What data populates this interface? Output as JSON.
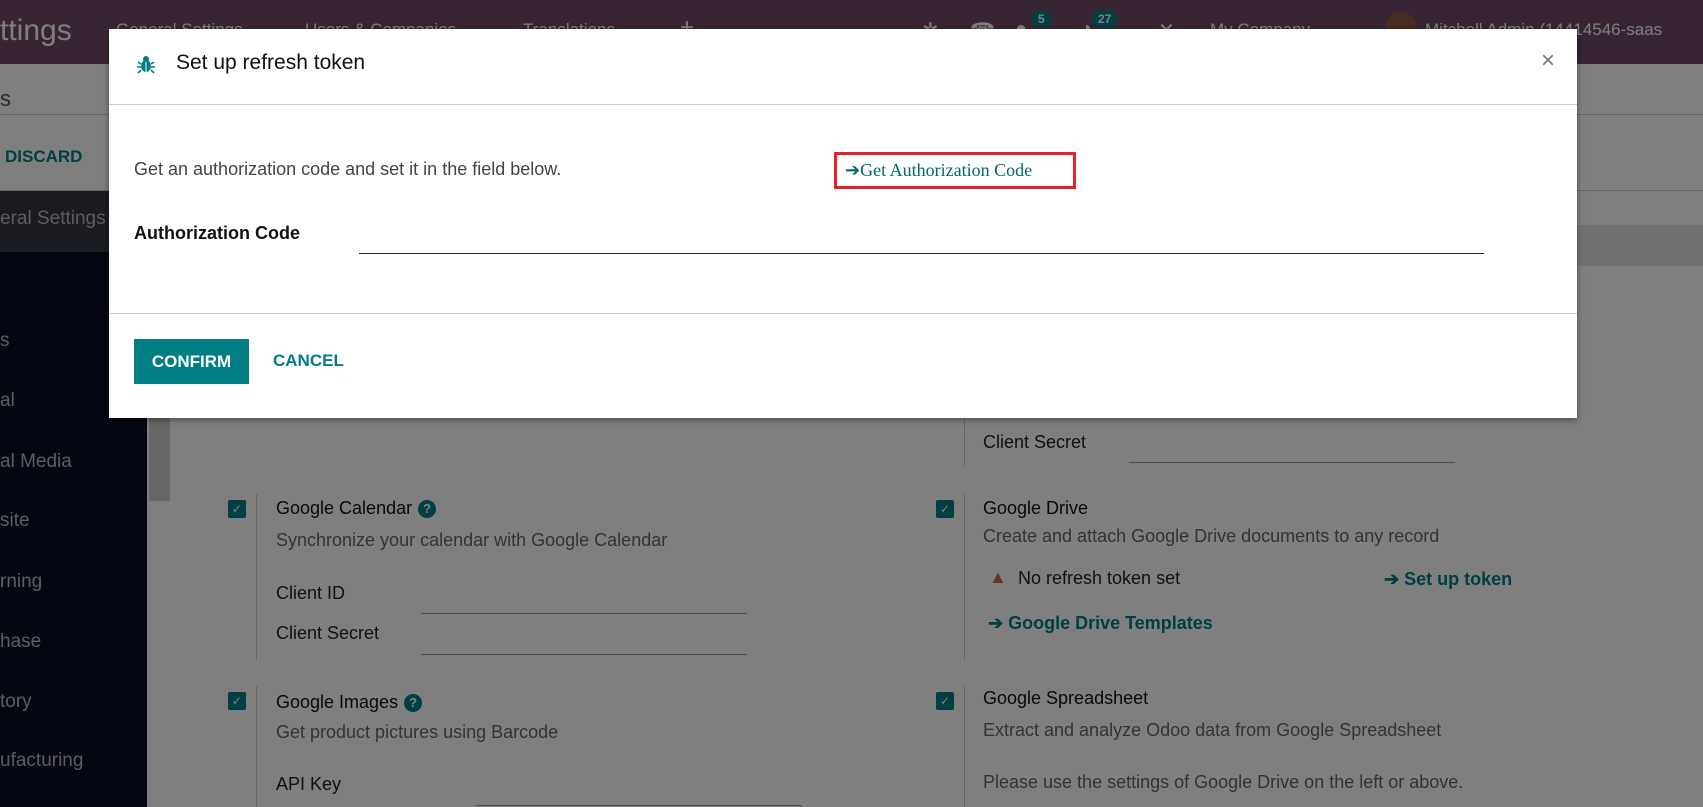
{
  "navbar": {
    "app_title": "ttings",
    "menus": [
      "General Settings",
      "Users & Companies",
      "Translations",
      "+"
    ],
    "messages_count": "5",
    "activities_count": "27",
    "company": "My Company",
    "user": "Mitchell Admin (14414546-saas"
  },
  "control_panel": {
    "breadcrumb_tail": "s",
    "discard_label": "DISCARD"
  },
  "sidebar": {
    "items": [
      "eral Settings",
      "s",
      "al",
      "al Media",
      "site",
      "rning",
      "hase",
      "tory",
      "ufacturing"
    ]
  },
  "settings": {
    "right_top": {
      "client_secret_label": "Client Secret"
    },
    "google_calendar": {
      "title": "Google Calendar",
      "desc": "Synchronize your calendar with Google Calendar",
      "client_id_label": "Client ID",
      "client_secret_label": "Client Secret",
      "checked": true
    },
    "google_drive": {
      "title": "Google Drive",
      "desc": "Create and attach Google Drive documents to any record",
      "warning": "No refresh token set",
      "setup_link": "Set up token",
      "templates_link": "Google Drive Templates",
      "checked": true
    },
    "google_images": {
      "title": "Google Images",
      "desc": "Get product pictures using Barcode",
      "api_key_label": "API Key",
      "checked": true
    },
    "google_spreadsheet": {
      "title": "Google Spreadsheet",
      "desc": "Extract and analyze Odoo data from Google Spreadsheet",
      "note": "Please use the settings of Google Drive on the left or above.",
      "checked": true
    }
  },
  "modal": {
    "title": "Set up refresh token",
    "close": "×",
    "intro": "Get an authorization code and set it in the field below.",
    "auth_link": "Get Authorization Code",
    "auth_label": "Authorization Code",
    "auth_value": "",
    "confirm_label": "CONFIRM",
    "cancel_label": "CANCEL"
  },
  "colors": {
    "brand": "#714b67",
    "accent": "#017e84",
    "highlight_box": "#e8202a"
  }
}
